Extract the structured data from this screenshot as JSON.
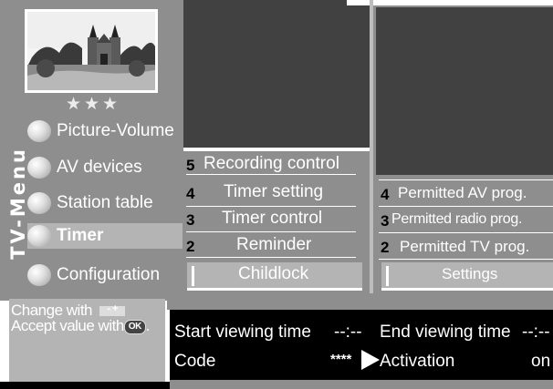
{
  "menu": {
    "vertical_title": "TV-Menu",
    "stars": "★ ★ ★",
    "items": [
      {
        "label": "Picture-Volume"
      },
      {
        "label": "AV devices"
      },
      {
        "label": "Station table"
      },
      {
        "label": "Timer"
      },
      {
        "label": "Configuration"
      }
    ],
    "selected": "Timer"
  },
  "timer_submenu": {
    "items": [
      {
        "number": "5",
        "label": "Recording control"
      },
      {
        "number": "4",
        "label": "Timer setting"
      },
      {
        "number": "3",
        "label": "Timer control"
      },
      {
        "number": "2",
        "label": "Reminder"
      },
      {
        "number": "",
        "label": "Childlock"
      }
    ],
    "selected": "Childlock"
  },
  "childlock_submenu": {
    "items": [
      {
        "number": "4",
        "label": "Permitted AV prog."
      },
      {
        "number": "3",
        "label": "Permitted radio prog."
      },
      {
        "number": "2",
        "label": "Permitted TV prog."
      },
      {
        "number": "",
        "label": "Settings"
      }
    ],
    "selected": "Settings"
  },
  "hints": {
    "change_with": "Change with",
    "accept_value_with": "Accept value with",
    "ok_label": "OK",
    "plusminus_label": "- +"
  },
  "settings": {
    "start_viewing_time_label": "Start viewing time",
    "start_viewing_time_value": "--:--",
    "end_viewing_time_label": "End viewing time",
    "end_viewing_time_value": "--:--",
    "code_label": "Code",
    "code_value": "****",
    "activation_label": "Activation",
    "activation_value": "on"
  }
}
